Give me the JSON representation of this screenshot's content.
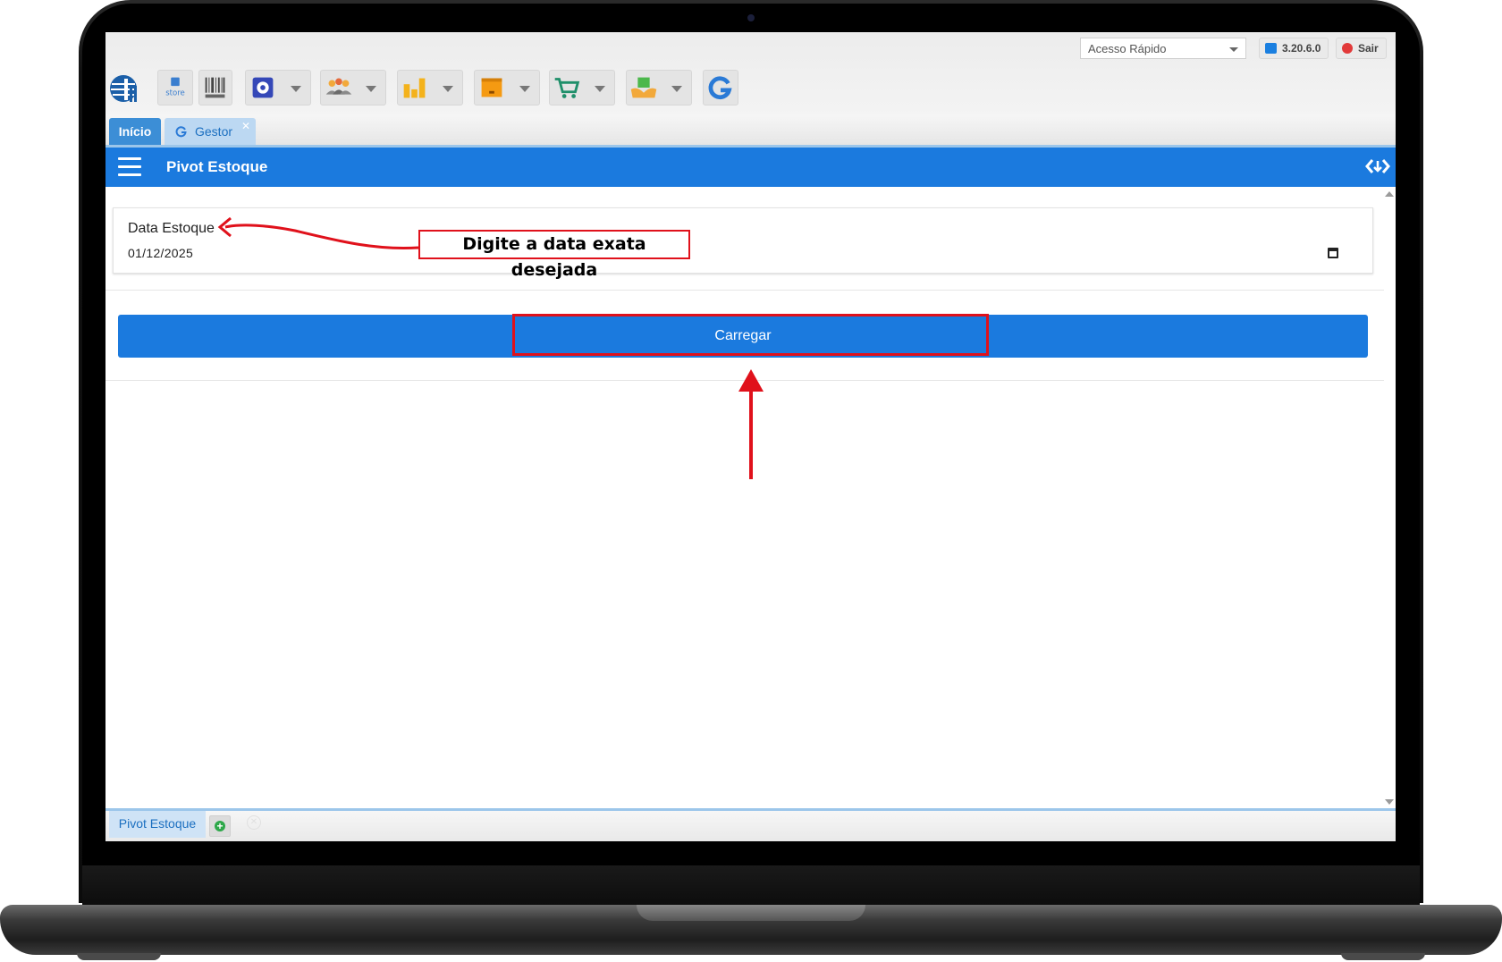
{
  "topbar": {
    "quick_access_placeholder": "Acesso Rápido",
    "version_label": "3.20.6.0",
    "logout_label": "Sair"
  },
  "toolbar": {
    "items": [
      {
        "name": "logo",
        "icon": "globe-logo-icon"
      },
      {
        "name": "store",
        "icon": "store-icon"
      },
      {
        "name": "boleto",
        "icon": "barcode-icon"
      },
      {
        "name": "settings",
        "icon": "gear-icon",
        "dropdown": true
      },
      {
        "name": "users",
        "icon": "users-icon",
        "dropdown": true
      },
      {
        "name": "reports",
        "icon": "bar-chart-icon",
        "dropdown": true
      },
      {
        "name": "stock",
        "icon": "box-icon",
        "dropdown": true
      },
      {
        "name": "sales",
        "icon": "cart-icon",
        "dropdown": true
      },
      {
        "name": "products",
        "icon": "hand-box-icon",
        "dropdown": true
      },
      {
        "name": "gestor",
        "icon": "g-logo-icon"
      }
    ]
  },
  "tabs": [
    {
      "label": "Início",
      "active": true
    },
    {
      "label": "Gestor",
      "active": false,
      "closable": true
    }
  ],
  "header": {
    "title": "Pivot Estoque"
  },
  "form": {
    "date_label": "Data Estoque",
    "date_value": "01/12/2025"
  },
  "actions": {
    "load_label": "Carregar"
  },
  "bottom_tabs": [
    {
      "label": "Pivot Estoque"
    }
  ],
  "annotations": {
    "date_hint": "Digite a data exata desejada"
  },
  "colors": {
    "primary": "#1b7ade",
    "annotation_red": "#e0111b",
    "tab_active": "#3c8ed6"
  }
}
